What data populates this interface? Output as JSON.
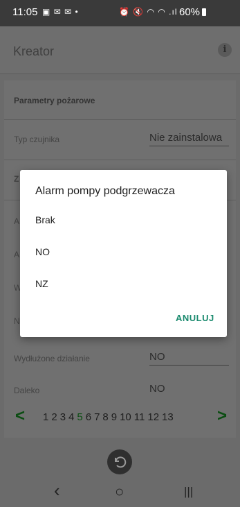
{
  "status_bar": {
    "time": "11:05",
    "notif_icons": "▣ ✉ ✉ •",
    "signal_icons": "⏰ 🔇 ◠ ◠ .ıl",
    "battery": "60%"
  },
  "app_bar": {
    "title": "Kreator",
    "info_icon": "i"
  },
  "section": {
    "title": "Parametry pożarowe"
  },
  "rows": [
    {
      "label": "Typ czujnika",
      "value": "Nie zainstalowa"
    },
    {
      "label": "Z",
      "value": ""
    },
    {
      "label": "A",
      "value": ""
    },
    {
      "label": "A",
      "value": ""
    },
    {
      "label": "W",
      "value": ""
    },
    {
      "label": "N",
      "value": ""
    },
    {
      "label": "Wydłużone działanie",
      "value": "NO"
    },
    {
      "label": "Daleko",
      "value": "NO"
    }
  ],
  "pager": {
    "prev": "<",
    "next": ">",
    "pages": [
      "1",
      "2",
      "3",
      "4",
      "5",
      "6",
      "7",
      "8",
      "9",
      "10",
      "11",
      "12",
      "13"
    ],
    "active_page": "5"
  },
  "back_icon": "↺",
  "nav": {
    "back": "‹",
    "home": "○",
    "recents": "|||"
  },
  "dialog": {
    "title": "Alarm pompy podgrzewacza",
    "options": [
      "Brak",
      "NO",
      "NZ"
    ],
    "cancel_label": "ANULUJ"
  },
  "colors": {
    "accent": "#1a8a6e",
    "pager_active": "#0b4d12"
  }
}
